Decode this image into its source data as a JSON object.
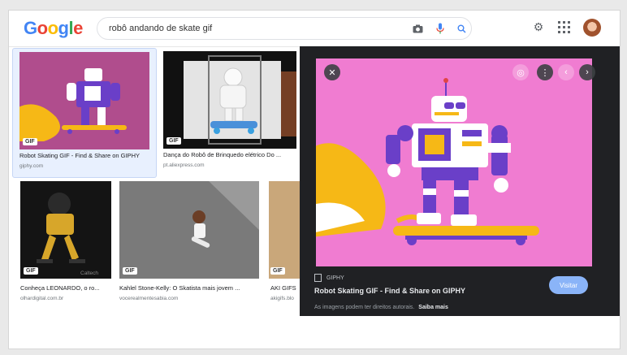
{
  "logo": {
    "text": "Google"
  },
  "search": {
    "query": "robô andando de skate gif"
  },
  "results": [
    {
      "badge": "GIF",
      "title": "Robot Skating GIF - Find & Share on GIPHY",
      "source": "giphy.com"
    },
    {
      "badge": "GIF",
      "title": "Dança do Robô de Brinquedo elétrico Do ...",
      "source": "pt.aliexpress.com"
    },
    {
      "badge": "GIF",
      "title": "Conheça LEONARDO, o ro...",
      "source": "olhardigital.com.br",
      "watermark": "Caltech"
    },
    {
      "badge": "GIF",
      "title": "Kahlel Stone-Kelly: O Skatista mais jovem ...",
      "source": "vocerealmentesabia.com"
    },
    {
      "badge": "GIF",
      "title": "AKI GIFS",
      "source": "akigifs.blo"
    }
  ],
  "panel": {
    "source": "GIPHY",
    "title": "Robot Skating GIF - Find & Share on GIPHY",
    "visit": "Visitar",
    "notice": "As imagens podem ter direitos autorais.",
    "learn_more": "Saiba mais"
  },
  "colors": {
    "panel_bg": "#202124",
    "image_bg": "#f07cd1",
    "robot_purple": "#6a3fc8",
    "robot_yellow": "#f6b816",
    "visit_button": "#8ab4f8"
  }
}
